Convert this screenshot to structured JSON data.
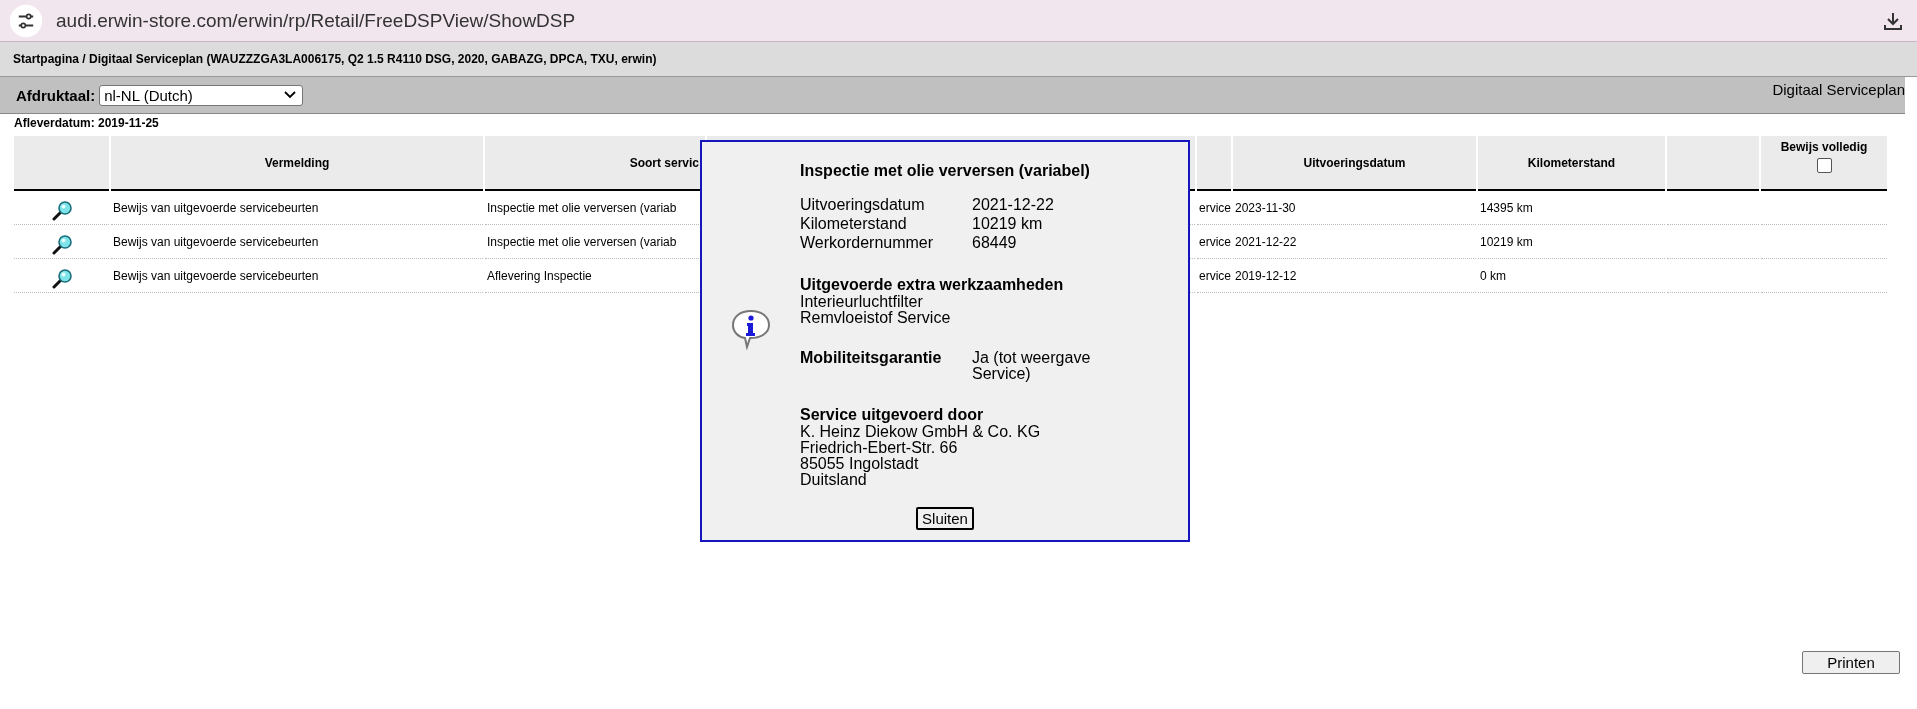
{
  "address_bar": {
    "url": "audi.erwin-store.com/erwin/rp/Retail/FreeDSPView/ShowDSP"
  },
  "breadcrumb": "Startpagina / Digitaal Serviceplan (WAUZZZGA3LA006175, Q2 1.5 R4110 DSG, 2020, GABAZG, DPCA, TXU, erwin)",
  "toolbar": {
    "language_label": "Afdruktaal:",
    "language_value": "nl-NL (Dutch)",
    "title": "Digitaal Serviceplan"
  },
  "delivery_date": "Afleverdatum: 2019-11-25",
  "table": {
    "columns": {
      "entry": "Vermelding",
      "service_type": "Soort servic",
      "date": "Uitvoeringsdatum",
      "mileage": "Kilometerstand",
      "proof_complete": "Bewijs volledig"
    },
    "proof_complete_checked": false,
    "rows": [
      {
        "entry": "Bewijs van uitgevoerde servicebeurten",
        "service_type": "Inspectie met olie verversen (variab",
        "column_4": "ervice",
        "date": "2023-11-30",
        "mileage": "14395 km"
      },
      {
        "entry": "Bewijs van uitgevoerde servicebeurten",
        "service_type": "Inspectie met olie verversen (variab",
        "column_4": "ervice",
        "date": "2021-12-22",
        "mileage": "10219 km"
      },
      {
        "entry": "Bewijs van uitgevoerde servicebeurten",
        "service_type": "Aflevering Inspectie",
        "column_4": "ervice",
        "date": "2019-12-12",
        "mileage": "0 km"
      }
    ]
  },
  "dialog": {
    "title": "Inspectie met olie verversen (variabel)",
    "fields": [
      {
        "label": "Uitvoeringsdatum",
        "value": "2021-12-22"
      },
      {
        "label": "Kilometerstand",
        "value": "10219 km"
      },
      {
        "label": "Werkordernummer",
        "value": "68449"
      }
    ],
    "extra_work": {
      "heading": "Uitgevoerde extra werkzaamheden",
      "items": [
        "Interieurluchtfilter",
        "Remvloeistof Service"
      ]
    },
    "mobility": {
      "label": "Mobiliteitsgarantie",
      "value": "Ja (tot weergave Service)"
    },
    "performed_by": {
      "heading": "Service uitgevoerd door",
      "lines": [
        "K. Heinz Diekow GmbH & Co. KG",
        "Friedrich-Ebert-Str. 66",
        "85055 Ingolstadt",
        "Duitsland"
      ]
    },
    "close_button": "Sluiten"
  },
  "print_button": "Printen"
}
